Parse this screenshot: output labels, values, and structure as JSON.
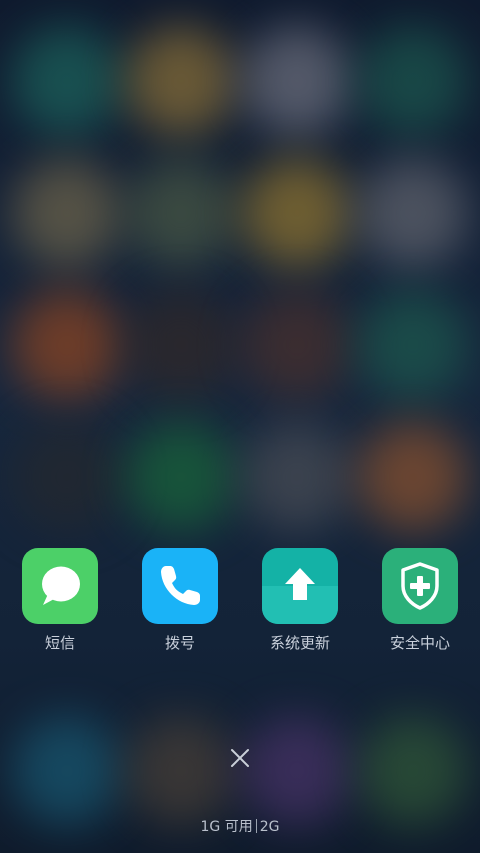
{
  "apps": [
    {
      "label": "短信",
      "icon": "message-bubble-icon"
    },
    {
      "label": "拨号",
      "icon": "phone-handset-icon"
    },
    {
      "label": "系统更新",
      "icon": "upload-arrow-icon"
    },
    {
      "label": "安全中心",
      "icon": "shield-plus-icon"
    }
  ],
  "memory": {
    "available": "1G 可用",
    "total": "2G"
  },
  "colors": {
    "messages": "#4cd068",
    "dialer": "#1ab3f7",
    "update": "#14b2a6",
    "security": "#2bb07a"
  }
}
